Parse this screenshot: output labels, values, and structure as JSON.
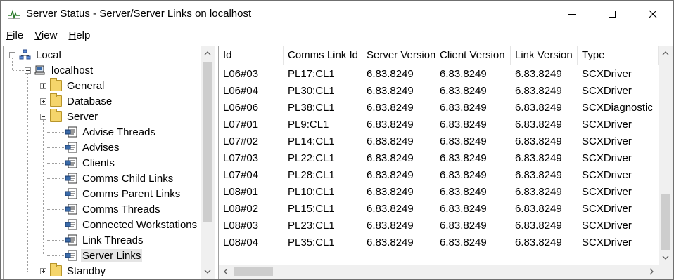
{
  "window": {
    "title": "Server Status - Server/Server Links on localhost",
    "icon": "pulse-icon"
  },
  "menu": [
    {
      "label": "File",
      "mnemonic": "F",
      "rest": "ile"
    },
    {
      "label": "View",
      "mnemonic": "V",
      "rest": "iew"
    },
    {
      "label": "Help",
      "mnemonic": "H",
      "rest": "elp"
    }
  ],
  "tree": {
    "nodes": [
      {
        "label": "Local",
        "icon": "network-icon",
        "expanded": true
      },
      {
        "label": "localhost",
        "icon": "computer-icon",
        "expanded": true
      },
      {
        "label": "General",
        "icon": "folder-icon",
        "expanded": false
      },
      {
        "label": "Database",
        "icon": "folder-icon",
        "expanded": false
      },
      {
        "label": "Server",
        "icon": "folder-icon",
        "expanded": true
      },
      {
        "label": "Advise Threads",
        "icon": "status-page-icon"
      },
      {
        "label": "Advises",
        "icon": "status-page-icon"
      },
      {
        "label": "Clients",
        "icon": "status-page-icon"
      },
      {
        "label": "Comms Child Links",
        "icon": "status-page-icon"
      },
      {
        "label": "Comms Parent Links",
        "icon": "status-page-icon"
      },
      {
        "label": "Comms Threads",
        "icon": "status-page-icon"
      },
      {
        "label": "Connected Workstations",
        "icon": "status-page-icon"
      },
      {
        "label": "Link Threads",
        "icon": "status-page-icon"
      },
      {
        "label": "Server Links",
        "icon": "status-page-icon",
        "selected": true
      },
      {
        "label": "Standby",
        "icon": "folder-icon",
        "expanded": false
      }
    ]
  },
  "table": {
    "columns": [
      "Id",
      "Comms Link Id",
      "Server Version",
      "Client Version",
      "Link Version",
      "Type"
    ],
    "rows": [
      [
        "L06#03",
        "PL17:CL1",
        "6.83.8249",
        "6.83.8249",
        "6.83.8249",
        "SCXDriver"
      ],
      [
        "L06#04",
        "PL30:CL1",
        "6.83.8249",
        "6.83.8249",
        "6.83.8249",
        "SCXDriver"
      ],
      [
        "L06#06",
        "PL38:CL1",
        "6.83.8249",
        "6.83.8249",
        "6.83.8249",
        "SCXDiagnostic"
      ],
      [
        "L07#01",
        "PL9:CL1",
        "6.83.8249",
        "6.83.8249",
        "6.83.8249",
        "SCXDriver"
      ],
      [
        "L07#02",
        "PL14:CL1",
        "6.83.8249",
        "6.83.8249",
        "6.83.8249",
        "SCXDriver"
      ],
      [
        "L07#03",
        "PL22:CL1",
        "6.83.8249",
        "6.83.8249",
        "6.83.8249",
        "SCXDriver"
      ],
      [
        "L07#04",
        "PL28:CL1",
        "6.83.8249",
        "6.83.8249",
        "6.83.8249",
        "SCXDriver"
      ],
      [
        "L08#01",
        "PL10:CL1",
        "6.83.8249",
        "6.83.8249",
        "6.83.8249",
        "SCXDriver"
      ],
      [
        "L08#02",
        "PL15:CL1",
        "6.83.8249",
        "6.83.8249",
        "6.83.8249",
        "SCXDriver"
      ],
      [
        "L08#03",
        "PL23:CL1",
        "6.83.8249",
        "6.83.8249",
        "6.83.8249",
        "SCXDriver"
      ],
      [
        "L08#04",
        "PL35:CL1",
        "6.83.8249",
        "6.83.8249",
        "6.83.8249",
        "SCXDriver"
      ]
    ]
  },
  "colors": {
    "selection": "#e5e5e5",
    "scrollbar_track": "#f0f0f0",
    "scrollbar_thumb": "#cdcdcd",
    "folder": "#f5d56b"
  }
}
